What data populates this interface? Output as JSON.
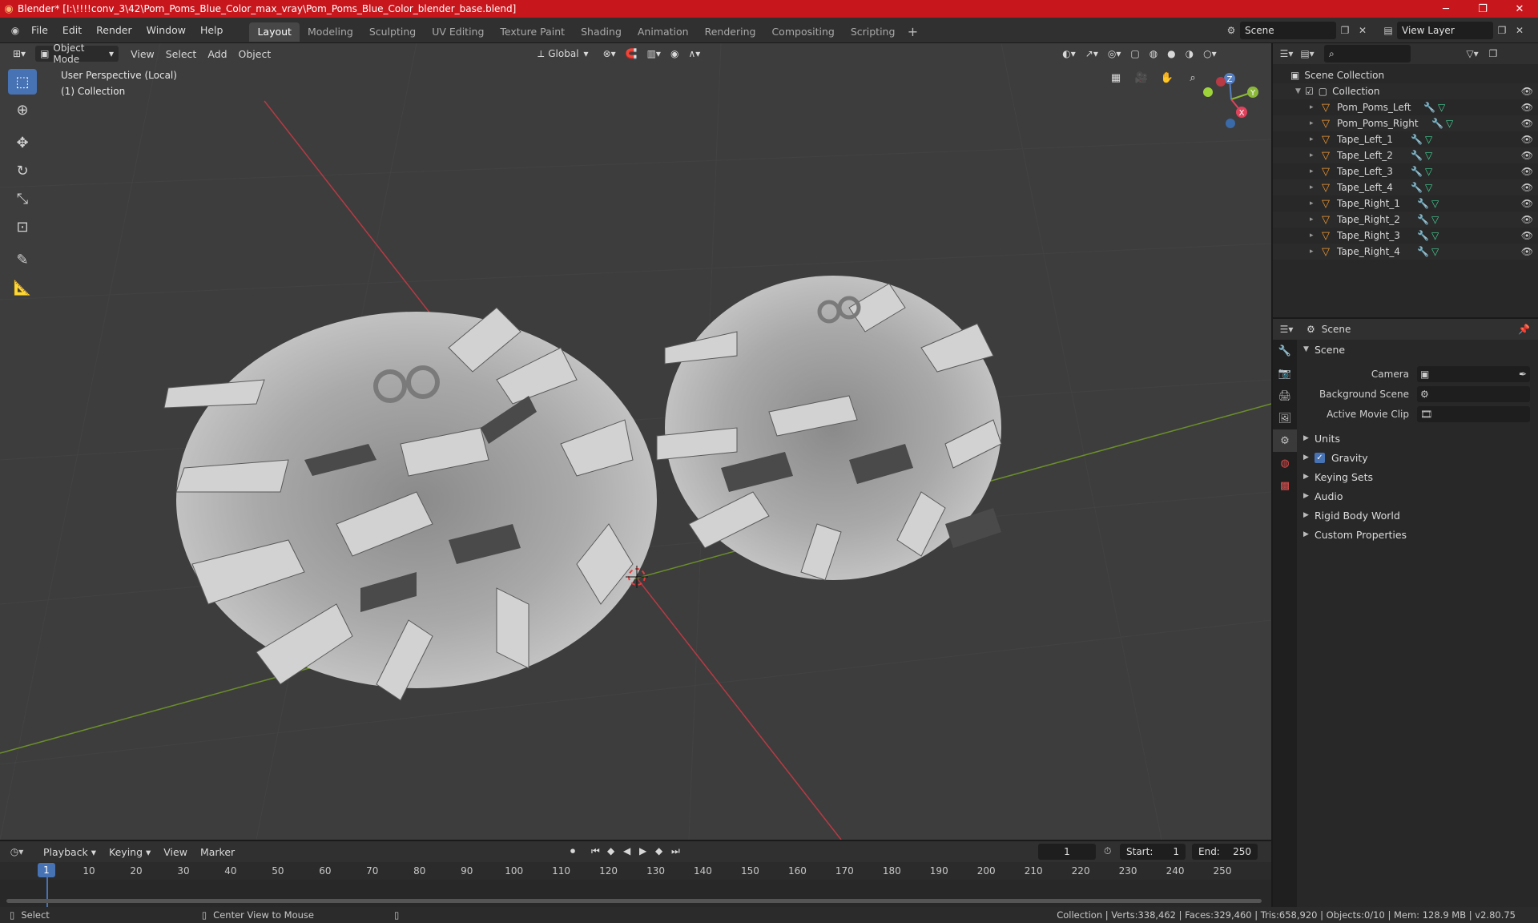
{
  "window": {
    "title": "Blender* [I:\\!!!!conv_3\\42\\Pom_Poms_Blue_Color_max_vray\\Pom_Poms_Blue_Color_blender_base.blend]",
    "minimize": "─",
    "maximize": "❐",
    "close": "✕"
  },
  "menu": {
    "items": [
      "File",
      "Edit",
      "Render",
      "Window",
      "Help"
    ]
  },
  "workspaces": [
    "Layout",
    "Modeling",
    "Sculpting",
    "UV Editing",
    "Texture Paint",
    "Shading",
    "Animation",
    "Rendering",
    "Compositing",
    "Scripting"
  ],
  "active_workspace": "Layout",
  "scene_selector": {
    "value": "Scene"
  },
  "view_layer_selector": {
    "value": "View Layer"
  },
  "viewport": {
    "mode": "Object Mode",
    "menus": [
      "View",
      "Select",
      "Add",
      "Object"
    ],
    "transform_orientation": "Global",
    "info_line1": "User Perspective (Local)",
    "info_line2": "(1) Collection",
    "gizmo_axes": {
      "z": "Z",
      "y": "Y",
      "x": "X"
    }
  },
  "outliner": {
    "root": "Scene Collection",
    "collection": "Collection",
    "objects": [
      "Pom_Poms_Left",
      "Pom_Poms_Right",
      "Tape_Left_1",
      "Tape_Left_2",
      "Tape_Left_3",
      "Tape_Left_4",
      "Tape_Right_1",
      "Tape_Right_2",
      "Tape_Right_3",
      "Tape_Right_4"
    ]
  },
  "properties": {
    "header_title": "Scene",
    "panel_title": "Scene",
    "camera_label": "Camera",
    "background_scene_label": "Background Scene",
    "active_movie_clip_label": "Active Movie Clip",
    "subpanels": [
      "Units",
      "Gravity",
      "Keying Sets",
      "Audio",
      "Rigid Body World",
      "Custom Properties"
    ],
    "gravity_checked": true
  },
  "timeline": {
    "menus": [
      "Playback",
      "Keying",
      "View",
      "Marker"
    ],
    "current_frame": "1",
    "start_label": "Start:",
    "start_value": "1",
    "end_label": "End:",
    "end_value": "250",
    "ruler": [
      "10",
      "20",
      "30",
      "40",
      "50",
      "60",
      "70",
      "80",
      "90",
      "100",
      "110",
      "120",
      "130",
      "140",
      "150",
      "160",
      "170",
      "180",
      "190",
      "200",
      "210",
      "220",
      "230",
      "240",
      "250"
    ],
    "cursor_label": "1"
  },
  "statusbar": {
    "select": "Select",
    "center_view": "Center View to Mouse",
    "stats": "Collection | Verts:338,462 | Faces:329,460 | Tris:658,920 | Objects:0/10 | Mem: 128.9 MB | v2.80.75"
  }
}
